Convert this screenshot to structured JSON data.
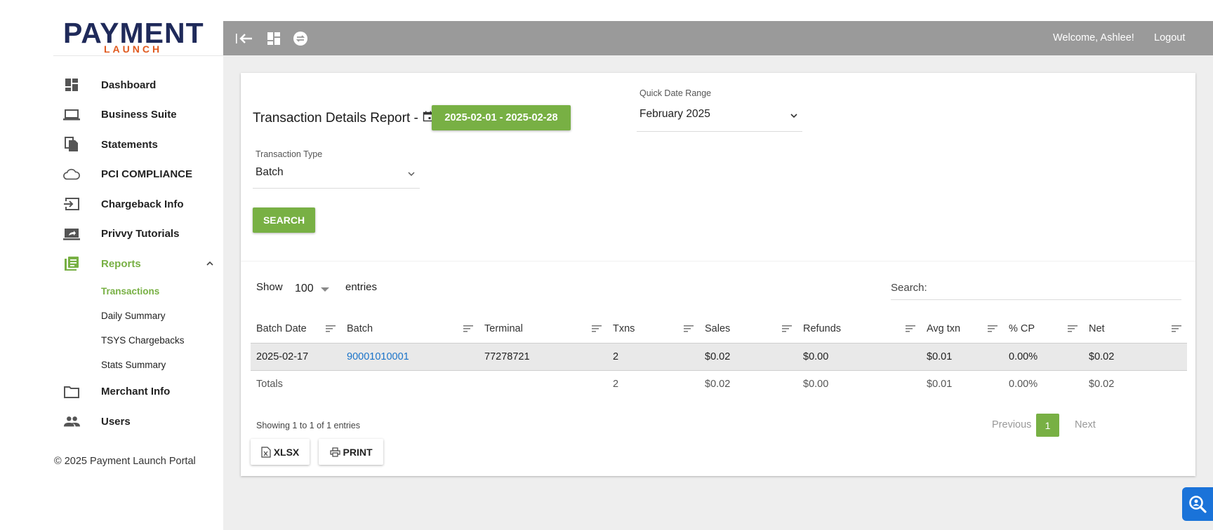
{
  "logo": {
    "main": "PAYMENT",
    "sub": "LAUNCH"
  },
  "sidebar": {
    "items": [
      {
        "label": "Dashboard",
        "icon": "dashboard-icon"
      },
      {
        "label": "Business Suite",
        "icon": "laptop-icon"
      },
      {
        "label": "Statements",
        "icon": "documents-icon"
      },
      {
        "label": "PCI COMPLIANCE",
        "icon": "cloud-icon"
      },
      {
        "label": "Chargeback Info",
        "icon": "input-icon"
      },
      {
        "label": "Privvy Tutorials",
        "icon": "screen-share-icon"
      },
      {
        "label": "Reports",
        "icon": "reports-icon"
      },
      {
        "label": "Merchant Info",
        "icon": "folder-icon"
      },
      {
        "label": "Users",
        "icon": "people-icon"
      }
    ],
    "reports_sub": [
      "Transactions",
      "Daily Summary",
      "TSYS Chargebacks",
      "Stats Summary"
    ],
    "copyright": "© 2025 Payment Launch Portal"
  },
  "topbar": {
    "welcome": "Welcome, Ashlee!",
    "logout": "Logout"
  },
  "report": {
    "title": "Transaction Details Report -",
    "date_range": "2025-02-01 - 2025-02-28",
    "quick_range_label": "Quick Date Range",
    "quick_range_value": "February 2025",
    "txn_type_label": "Transaction Type",
    "txn_type_value": "Batch",
    "search_button": "SEARCH"
  },
  "table": {
    "show_label": "Show",
    "page_length": "100",
    "entries_label": "entries",
    "search_label": "Search:",
    "columns": [
      "Batch Date",
      "Batch",
      "Terminal",
      "Txns",
      "Sales",
      "Refunds",
      "Avg txn",
      "% CP",
      "Net"
    ],
    "rows": [
      {
        "batch_date": "2025-02-17",
        "batch": "90001010001",
        "terminal": "77278721",
        "txns": "2",
        "sales": "$0.02",
        "refunds": "$0.00",
        "avg_txn": "$0.01",
        "pct_cp": "0.00%",
        "net": "$0.02"
      }
    ],
    "totals": {
      "label": "Totals",
      "txns": "2",
      "sales": "$0.02",
      "refunds": "$0.00",
      "avg_txn": "$0.01",
      "pct_cp": "0.00%",
      "net": "$0.02"
    },
    "info": "Showing 1 to 1 of 1 entries",
    "pagination": {
      "previous": "Previous",
      "current": "1",
      "next": "Next"
    },
    "export_xlsx": "XLSX",
    "export_print": "PRINT"
  },
  "colors": {
    "accent": "#78b044",
    "topbar": "#9a9a9a",
    "link": "#1a73c9",
    "logo_blue": "#1f2a5a",
    "logo_orange": "#e05a1f"
  }
}
